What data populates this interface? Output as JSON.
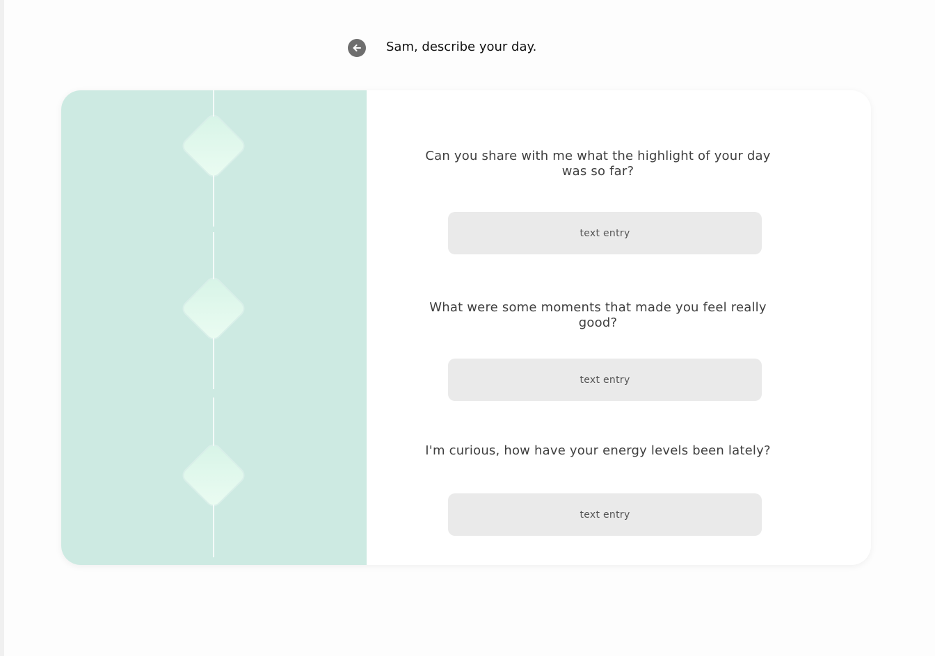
{
  "header": {
    "back_icon": "arrow-left-circle-icon",
    "title": "Sam, describe your day."
  },
  "colors": {
    "left_panel": "#cdeae2",
    "entry_background": "#eaeaea",
    "back_button": "#6e6e6e"
  },
  "questions": [
    {
      "prompt": "Can you share with me what the highlight of your day was so far?",
      "entry_placeholder": "text entry"
    },
    {
      "prompt": "What were some moments that made you feel really good?",
      "entry_placeholder": "text entry"
    },
    {
      "prompt": "I'm curious, how have your energy levels been lately?",
      "entry_placeholder": "text entry"
    }
  ]
}
